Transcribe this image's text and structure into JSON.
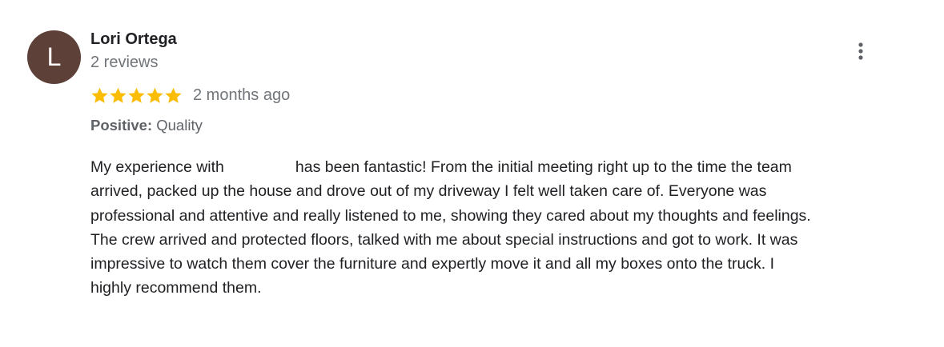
{
  "reviewer": {
    "initial": "L",
    "avatar_color": "#5d4037",
    "name": "Lori Ortega",
    "review_count": "2 reviews"
  },
  "rating": {
    "stars": 5,
    "max_stars": 5,
    "star_color": "#fbbc04",
    "timestamp": "2 months ago"
  },
  "attributes": {
    "label": "Positive:",
    "value": "Quality"
  },
  "review": {
    "line1_start": "My experience with",
    "line1_end": "has been fantastic!  From the initial meeting right up to the time the team",
    "line2": "arrived, packed up the house and drove out of my driveway I felt well taken care of. Everyone was",
    "line3": "professional and attentive and really listened to me, showing they cared about my thoughts and feelings.",
    "line4": "The crew arrived and protected floors, talked with me about special instructions and got to work. It was",
    "line5": "impressive to watch them cover the furniture and expertly move it and all my boxes  onto the truck. I",
    "line6": "highly recommend them."
  },
  "icons": {
    "more": "more-vert-icon",
    "star": "star-icon"
  }
}
